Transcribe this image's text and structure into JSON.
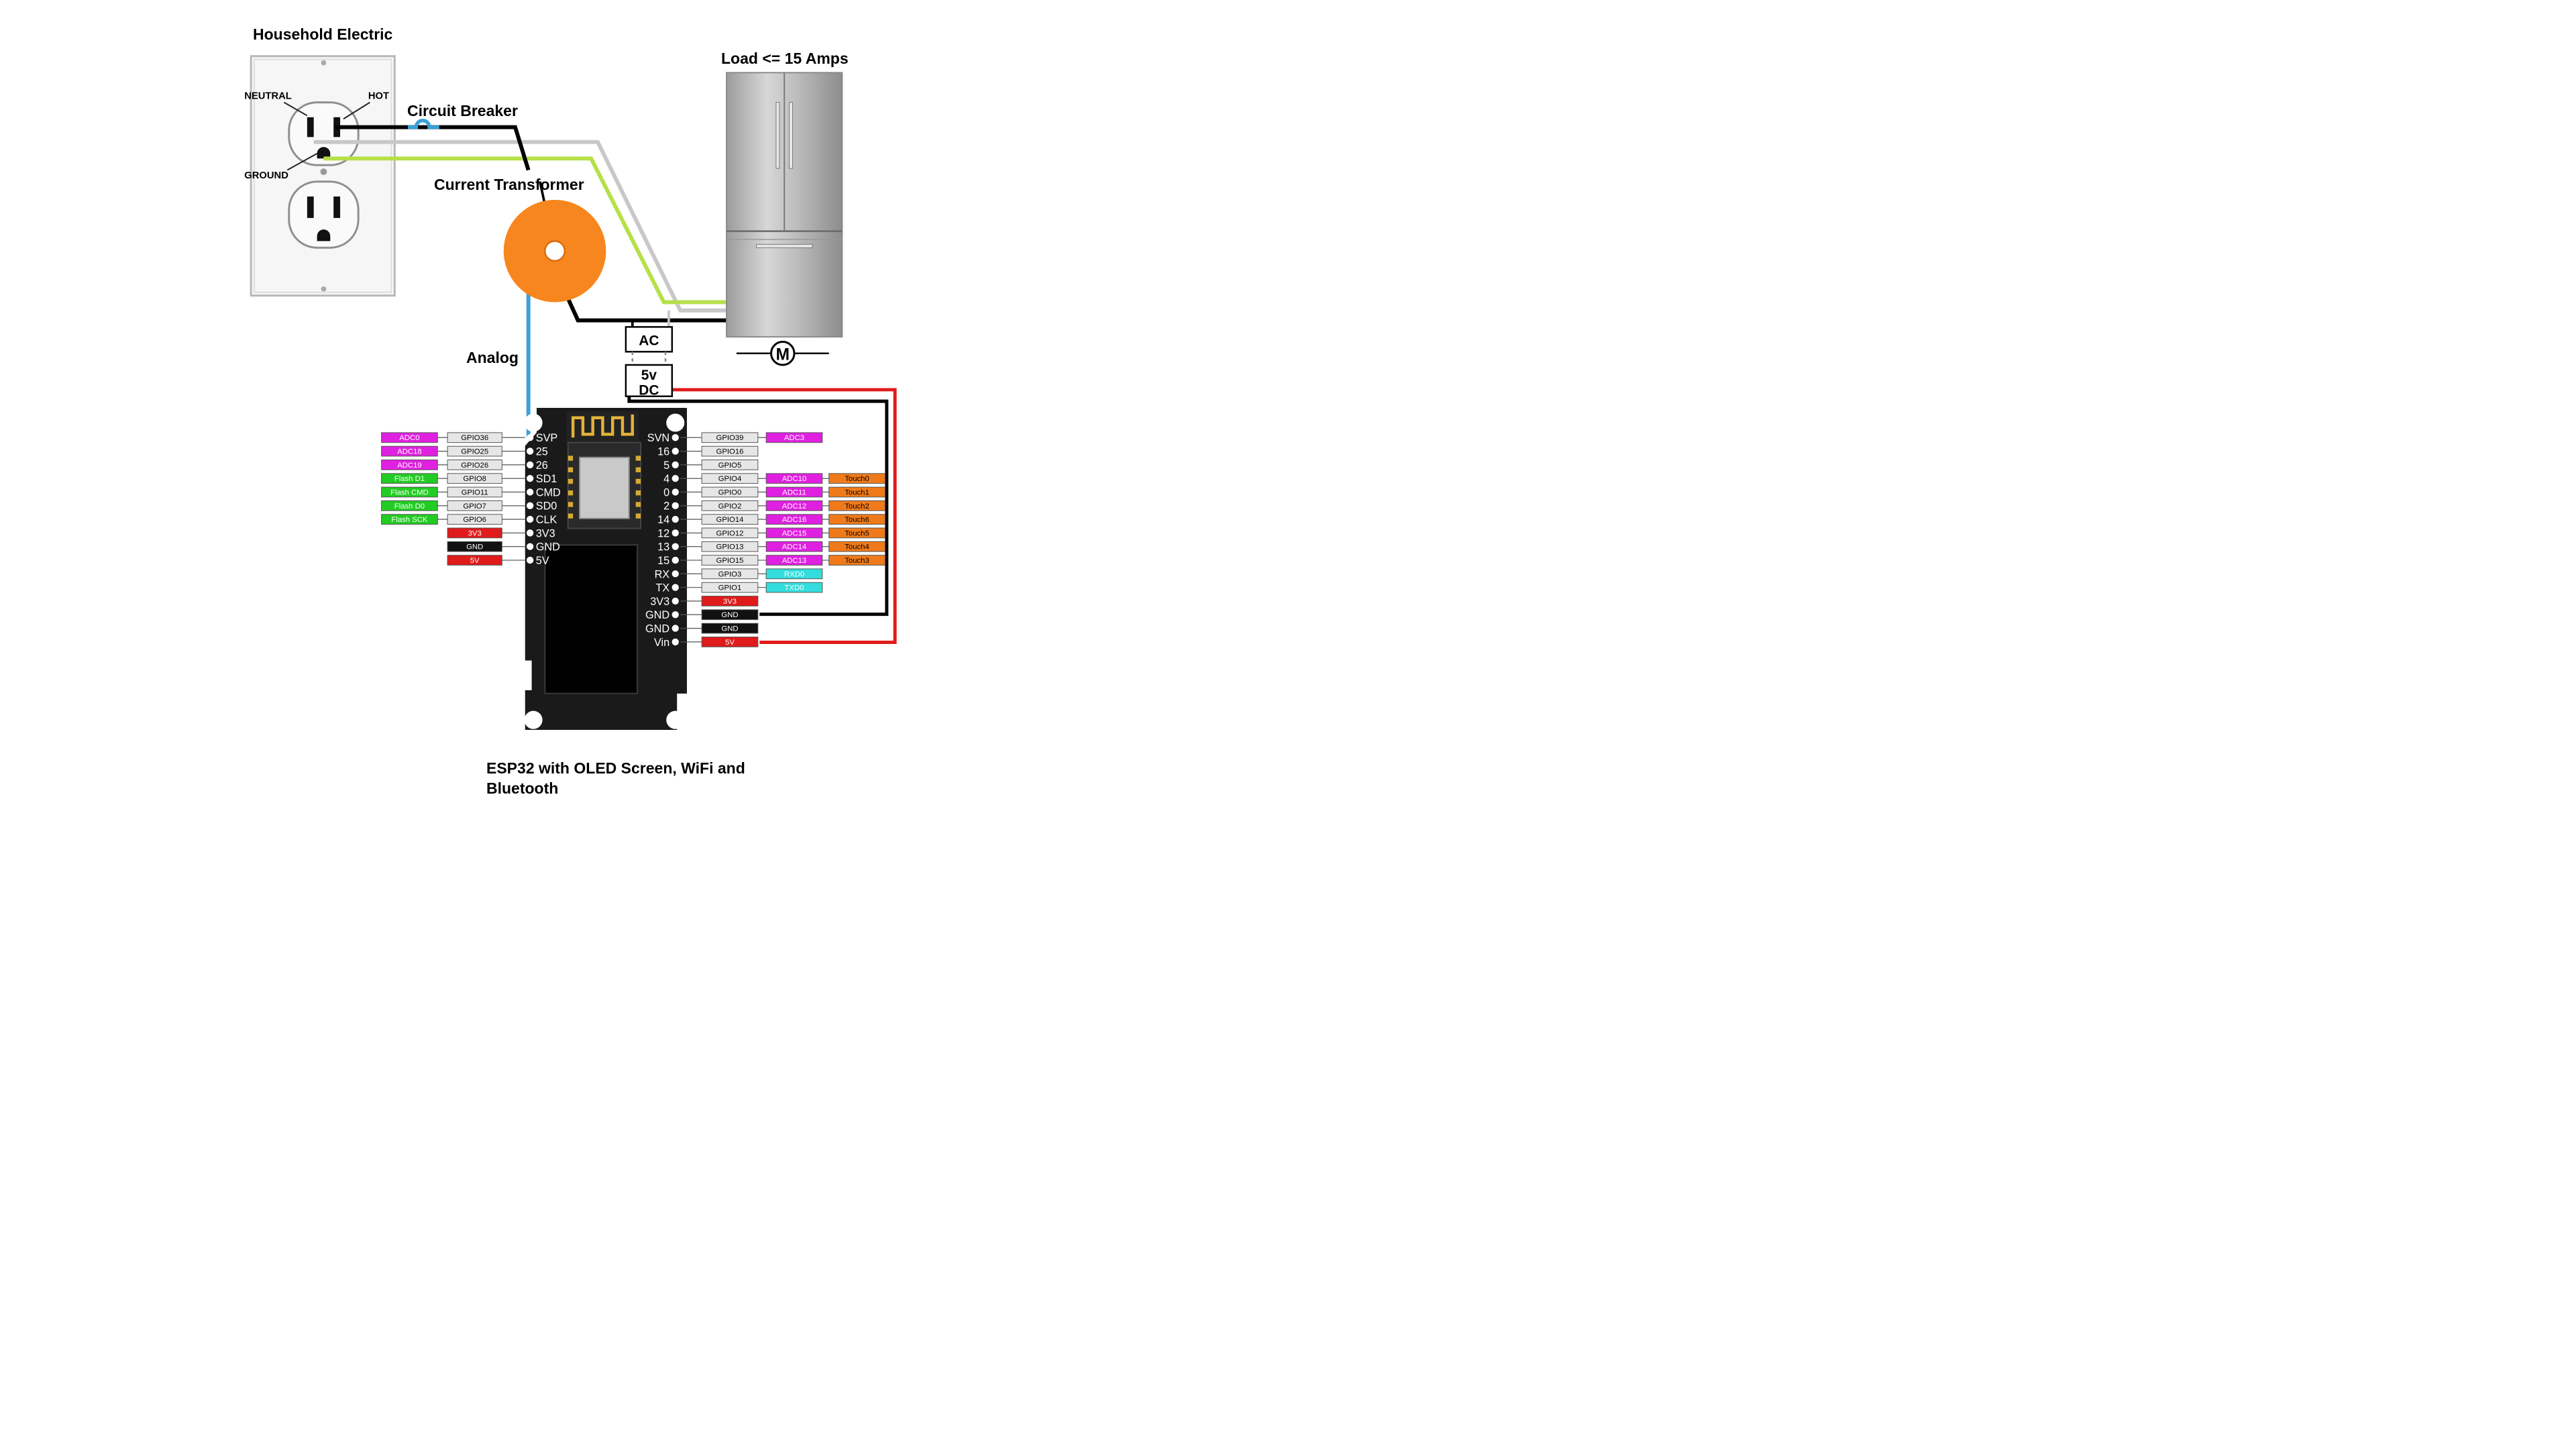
{
  "labels": {
    "household": "Household Electric",
    "neutral": "NEUTRAL",
    "hot": "HOT",
    "ground": "GROUND",
    "breaker": "Circuit Breaker",
    "transformer": "Current Transformer",
    "analog": "Analog",
    "load": "Load <= 15 Amps",
    "motor": "M",
    "ac": "AC",
    "dc_line1": "5v",
    "dc_line2": "DC",
    "caption_line1": "ESP32 with OLED Screen, WiFi and",
    "caption_line2": "Bluetooth"
  },
  "colors": {
    "hot_wire": "#000000",
    "neutral_wire": "#c8c8c8",
    "ground_wire": "#b6e04a",
    "analog_wire": "#3aa0d8",
    "positive_wire": "#e01b1b",
    "transformer": "#f7861e",
    "board": "#1a1a1a",
    "pin_gpio": "#e6e6e6",
    "pin_adc": "#e020e0",
    "pin_flash": "#22cc22",
    "pin_power": "#e01b1b",
    "pin_gnd": "#111111",
    "pin_touch": "#f07a1a",
    "pin_uart": "#33dddd"
  },
  "board": {
    "left_pins": [
      {
        "pin": "SVP",
        "gpio": "GPIO36",
        "func": "ADC0",
        "func_type": "adc"
      },
      {
        "pin": "25",
        "gpio": "GPIO25",
        "func": "ADC18",
        "func_type": "adc"
      },
      {
        "pin": "26",
        "gpio": "GPIO26",
        "func": "ADC19",
        "func_type": "adc"
      },
      {
        "pin": "SD1",
        "gpio": "GPIO8",
        "func": "Flash D1",
        "func_type": "flash"
      },
      {
        "pin": "CMD",
        "gpio": "GPIO11",
        "func": "Flash CMD",
        "func_type": "flash"
      },
      {
        "pin": "SD0",
        "gpio": "GPIO7",
        "func": "Flash D0",
        "func_type": "flash"
      },
      {
        "pin": "CLK",
        "gpio": "GPIO6",
        "func": "Flash SCK",
        "func_type": "flash"
      },
      {
        "pin": "3V3",
        "gpio": "3V3",
        "func": "",
        "func_type": "power"
      },
      {
        "pin": "GND",
        "gpio": "GND",
        "func": "",
        "func_type": "gnd"
      },
      {
        "pin": "5V",
        "gpio": "5V",
        "func": "",
        "func_type": "power"
      }
    ],
    "right_pins": [
      {
        "pin": "SVN",
        "gpio": "GPIO39",
        "adc": "ADC3",
        "touch": "",
        "adc_type": "adc"
      },
      {
        "pin": "16",
        "gpio": "GPIO16",
        "adc": "",
        "touch": "",
        "adc_type": ""
      },
      {
        "pin": "5",
        "gpio": "GPIO5",
        "adc": "",
        "touch": "",
        "adc_type": ""
      },
      {
        "pin": "4",
        "gpio": "GPIO4",
        "adc": "ADC10",
        "touch": "Touch0",
        "adc_type": "adc"
      },
      {
        "pin": "0",
        "gpio": "GPIO0",
        "adc": "ADC11",
        "touch": "Touch1",
        "adc_type": "adc"
      },
      {
        "pin": "2",
        "gpio": "GPIO2",
        "adc": "ADC12",
        "touch": "Touch2",
        "adc_type": "adc"
      },
      {
        "pin": "14",
        "gpio": "GPIO14",
        "adc": "ADC16",
        "touch": "Touch6",
        "adc_type": "adc"
      },
      {
        "pin": "12",
        "gpio": "GPIO12",
        "adc": "ADC15",
        "touch": "Touch5",
        "adc_type": "adc"
      },
      {
        "pin": "13",
        "gpio": "GPIO13",
        "adc": "ADC14",
        "touch": "Touch4",
        "adc_type": "adc"
      },
      {
        "pin": "15",
        "gpio": "GPIO15",
        "adc": "ADC13",
        "touch": "Touch3",
        "adc_type": "adc"
      },
      {
        "pin": "RX",
        "gpio": "GPIO3",
        "adc": "RXD0",
        "touch": "",
        "adc_type": "uart"
      },
      {
        "pin": "TX",
        "gpio": "GPIO1",
        "adc": "TXD0",
        "touch": "",
        "adc_type": "uart"
      },
      {
        "pin": "3V3",
        "gpio": "3V3",
        "adc": "",
        "touch": "",
        "adc_type": "power"
      },
      {
        "pin": "GND",
        "gpio": "GND",
        "adc": "",
        "touch": "",
        "adc_type": "gnd"
      },
      {
        "pin": "GND",
        "gpio": "GND",
        "adc": "",
        "touch": "",
        "adc_type": "gnd"
      },
      {
        "pin": "Vin",
        "gpio": "5V",
        "adc": "",
        "touch": "",
        "adc_type": "power"
      }
    ]
  }
}
